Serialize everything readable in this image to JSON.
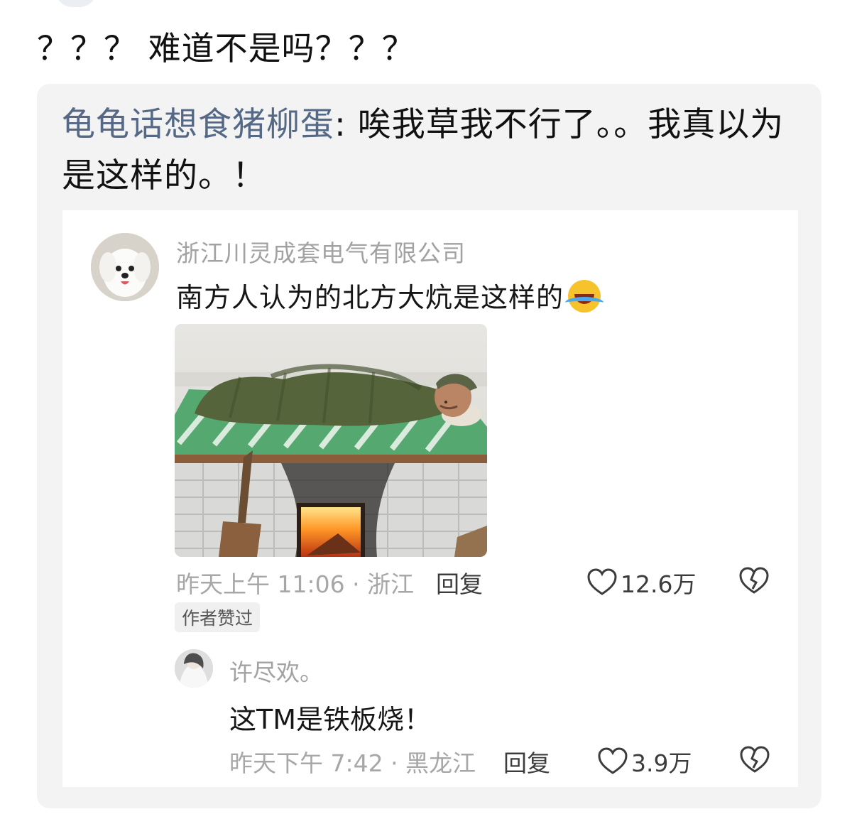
{
  "post": {
    "text": "？？？ 难道不是吗？？？"
  },
  "quote": {
    "username": "龟龟话想食猪柳蛋",
    "separator": ": ",
    "text": "唉我草我不行了。。我真以为是这样的。！"
  },
  "comment": {
    "username": "浙江川灵成套电气有限公司",
    "text": "南方人认为的北方大炕是这样的",
    "emoji": "laughing-crying-emoji",
    "time_location": "昨天上午 11:06 · 浙江",
    "reply_label": "回复",
    "likes": "12.6万",
    "author_badge": "作者赞过"
  },
  "reply": {
    "username": "许尽欢。",
    "text": "这TM是铁板烧！",
    "time_location": "昨天下午 7:42 · 黑龙江",
    "reply_label": "回复",
    "likes": "3.9万"
  },
  "colors": {
    "username_blue": "#556987",
    "card_bg": "#f3f3f4",
    "muted_text": "#a2a2a2"
  }
}
